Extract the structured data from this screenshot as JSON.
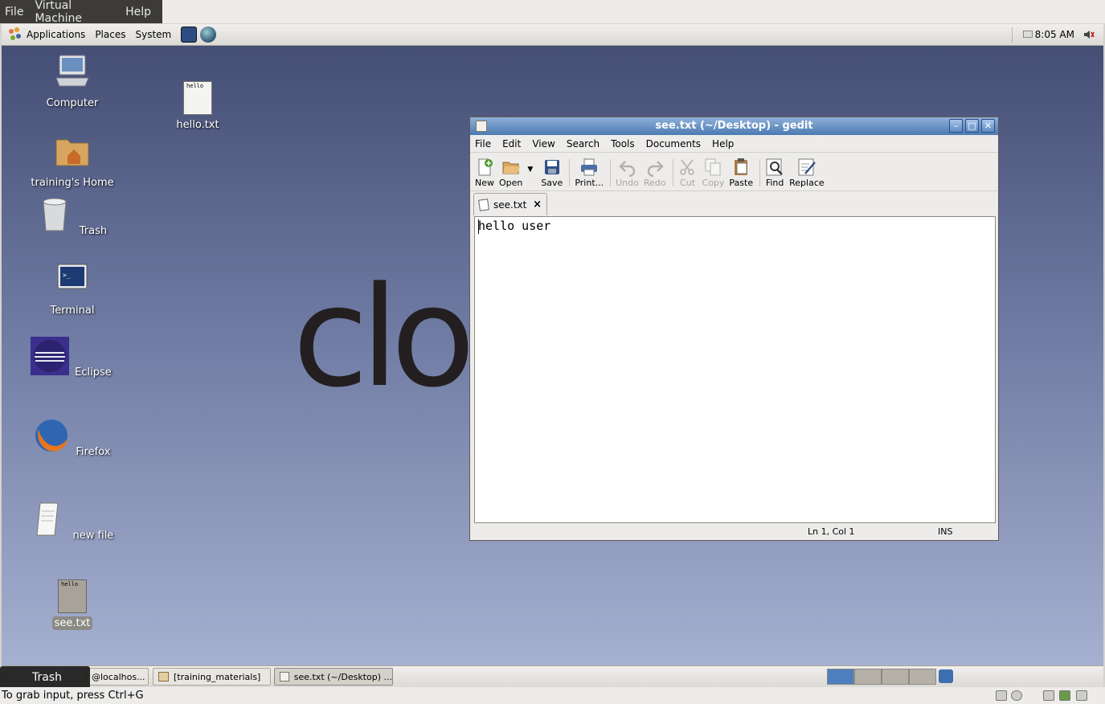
{
  "host_menu": {
    "file": "File",
    "vm": "Virtual Machine",
    "help": "Help"
  },
  "top_panel": {
    "applications": "Applications",
    "places": "Places",
    "system": "System",
    "clock": "8:05 AM"
  },
  "desktop": {
    "icons": {
      "computer": "Computer",
      "home": "training's Home",
      "trash": "Trash",
      "terminal": "Terminal",
      "eclipse": "Eclipse",
      "firefox": "Firefox",
      "new_file": "new file",
      "see_txt": "see.txt",
      "hello_txt": "hello.txt"
    },
    "file_thumb_text": "hello",
    "wallpaper_text": "clo"
  },
  "gedit": {
    "title": "see.txt (~/Desktop) - gedit",
    "menu": [
      "File",
      "Edit",
      "View",
      "Search",
      "Tools",
      "Documents",
      "Help"
    ],
    "toolbar": {
      "new": "New",
      "open": "Open",
      "save": "Save",
      "print": "Print...",
      "undo": "Undo",
      "redo": "Redo",
      "cut": "Cut",
      "copy": "Copy",
      "paste": "Paste",
      "find": "Find",
      "replace": "Replace"
    },
    "tab_label": "see.txt",
    "content": "hello user",
    "status_position": "Ln 1, Col 1",
    "status_mode": "INS"
  },
  "bottom_panel": {
    "tooltip": "Trash",
    "tasks": [
      "@localhos...",
      "[training_materials]",
      "see.txt (~/Desktop) ..."
    ]
  },
  "vm_status": "To grab input, press Ctrl+G"
}
